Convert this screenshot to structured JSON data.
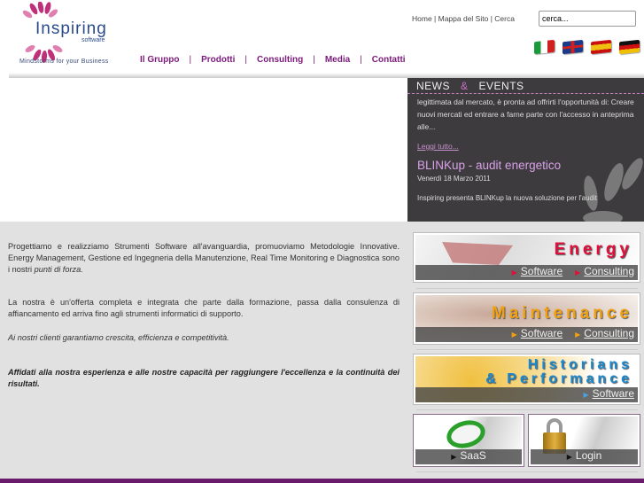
{
  "header": {
    "brand": "Inspiring",
    "brand_sub": "software",
    "tagline": "Mindstorms for your Business",
    "nav": [
      "Il Gruppo",
      "Prodotti",
      "Consulting",
      "Media",
      "Contatti"
    ],
    "top_links": [
      "Home",
      "Mappa del Sito",
      "Cerca"
    ],
    "search": {
      "value": "cerca..."
    },
    "flags": [
      "italian-flag-icon",
      "uk-flag-icon",
      "spanish-flag-icon",
      "german-flag-icon"
    ]
  },
  "news": {
    "title_a": "NEWS",
    "amp": "&",
    "title_b": "EVENTS",
    "body": "legittimata dal mercato, è pronta ad offrirti l'opportunità di: Creare nuovi mercati ed entrare a farne parte con l'accesso in anteprima alle...",
    "more": "Leggi tutto...",
    "headline": "BLINKup - audit energetico",
    "date": "Venerdì 18 Marzo 2011",
    "intro": "Inspiring presenta BLINKup la nuova soluzione per l'audit"
  },
  "content": {
    "p1a": "Progettiamo e realizziamo Strumenti Software all'avanguardia, promuoviamo Metodologie Innovative. Energy Management, Gestione ed Ingegneria della Manutenzione, Real Time Monitoring e Diagnostica sono i nostri ",
    "p1b": "punti di forza.",
    "p2": "La nostra è un'offerta completa e integrata che parte dalla formazione, passa dalla consulenza di affiancamento ed arriva fino agli strumenti informatici di supporto.",
    "p3": "Ai nostri clienti garantiamo crescita, efficienza e competitività.",
    "p4": "Affidati alla nostra esperienza e alle nostre capacità per raggiungere l'eccellenza e la continuità dei risultati."
  },
  "tiles": {
    "energy": {
      "label": "Energy",
      "software": "Software",
      "consulting": "Consulting",
      "color": "#e0103a"
    },
    "maintenance": {
      "label": "Maintenance",
      "software": "Software",
      "consulting": "Consulting",
      "color": "#f0a010"
    },
    "historians": {
      "label1": "Historians",
      "label2": "& Performance",
      "software": "Software",
      "color": "#1a8ad0"
    },
    "saas": "SaaS",
    "login": "Login"
  }
}
